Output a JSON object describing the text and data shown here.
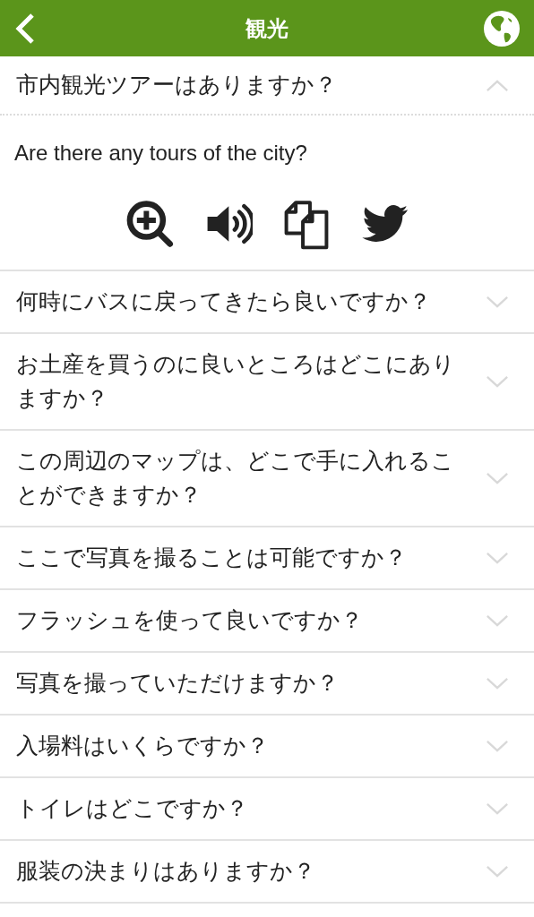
{
  "header": {
    "title": "観光"
  },
  "phrases": [
    {
      "question": "市内観光ツアーはありますか？",
      "expanded": true,
      "translation": "Are there any tours of the city?"
    },
    {
      "question": "何時にバスに戻ってきたら良いですか？",
      "expanded": false
    },
    {
      "question": "お土産を買うのに良いところはどこにありますか？",
      "expanded": false
    },
    {
      "question": "この周辺のマップは、どこで手に入れることができますか？",
      "expanded": false
    },
    {
      "question": "ここで写真を撮ることは可能ですか？",
      "expanded": false
    },
    {
      "question": "フラッシュを使って良いですか？",
      "expanded": false
    },
    {
      "question": "写真を撮っていただけますか？",
      "expanded": false
    },
    {
      "question": "入場料はいくらですか？",
      "expanded": false
    },
    {
      "question": "トイレはどこですか？",
      "expanded": false
    },
    {
      "question": "服装の決まりはありますか？",
      "expanded": false
    }
  ]
}
